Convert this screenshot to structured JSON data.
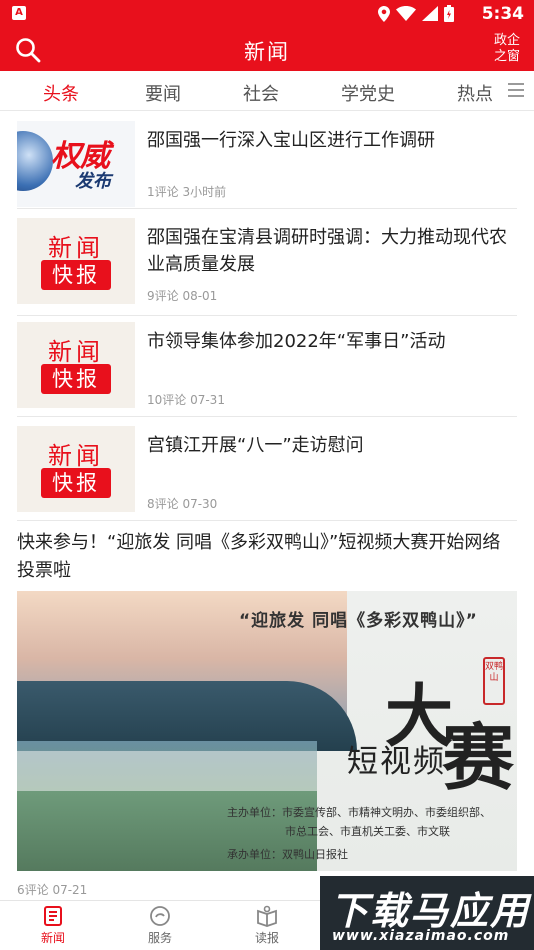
{
  "status_bar": {
    "time": "5:34",
    "left_icon_letter": "A"
  },
  "header": {
    "title": "新闻",
    "right_line1": "政企",
    "right_line2": "之窗"
  },
  "tabs": [
    {
      "label": "头条",
      "active": true
    },
    {
      "label": "要闻",
      "active": false
    },
    {
      "label": "社会",
      "active": false
    },
    {
      "label": "学党史",
      "active": false
    },
    {
      "label": "热点",
      "active": false
    }
  ],
  "thumb_text": {
    "quanwei_1": "权威",
    "quanwei_2": "发布",
    "kuaibao_1": "新闻",
    "kuaibao_2": "快报"
  },
  "news": [
    {
      "title": "邵国强一行深入宝山区进行工作调研",
      "meta": "1评论  3小时前",
      "thumb": "quanwei"
    },
    {
      "title": "邵国强在宝清县调研时强调：大力推动现代农业高质量发展",
      "meta": "9评论  08-01",
      "thumb": "kuaibao"
    },
    {
      "title": "市领导集体参加2022年“军事日”活动",
      "meta": "10评论  07-31",
      "thumb": "kuaibao"
    },
    {
      "title": "宫镇江开展“八一”走访慰问",
      "meta": "8评论  07-30",
      "thumb": "kuaibao"
    }
  ],
  "featured": {
    "title": "快来参与！“迎旅发 同唱《多彩双鸭山》”短视频大赛开始网络投票啦",
    "meta": "6评论  07-21",
    "banner": {
      "slogan": "“迎旅发  同唱《多彩双鸭山》”",
      "seal": "双鸭山",
      "big1": "大",
      "big2": "赛",
      "subtitle": "短视频",
      "organizers_line1": "主办单位：市委宣传部、市精神文明办、市委组织部、",
      "organizers_line2": "市总工会、市直机关工委、市文联",
      "undertaker": "承办单位：双鸭山日报社"
    }
  },
  "bottom_nav": [
    {
      "label": "新闻",
      "icon": "news-icon",
      "active": true
    },
    {
      "label": "服务",
      "icon": "service-icon",
      "active": false
    },
    {
      "label": "读报",
      "icon": "newspaper-icon",
      "active": false
    }
  ],
  "watermark": {
    "line1": "下载马应用",
    "line2": "www.xiazaimao.com"
  },
  "colors": {
    "brand": "#e8101c",
    "meta": "#999999"
  }
}
